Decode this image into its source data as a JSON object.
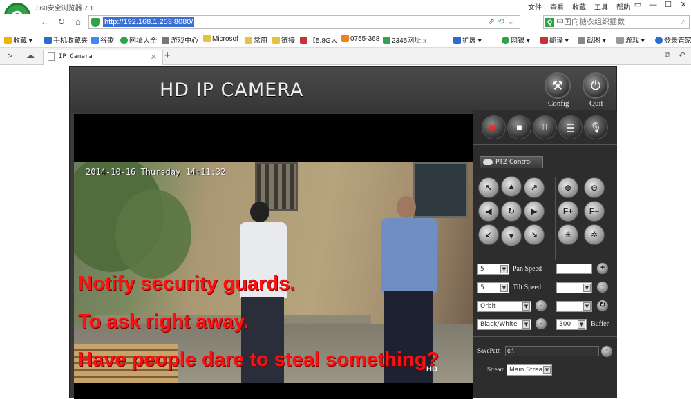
{
  "browser": {
    "app_title": "360安全浏览器 7.1",
    "menu": [
      "文件",
      "查看",
      "收藏",
      "工具",
      "帮助"
    ],
    "window_buttons": [
      "▭",
      "—",
      "☐",
      "✕"
    ],
    "logo_letter": "e",
    "url": "http://192.168.1.253:8080/",
    "search_placeholder": "中国向糖衣组织插数",
    "bookmarks": [
      "收藏",
      "手机收藏夹",
      "谷歌",
      "网址大全",
      "游戏中心",
      "Microsof",
      "常用",
      "链接",
      "【5.8G大",
      "0755-368",
      "2345网址",
      "扩展",
      "网银",
      "翻译",
      "截图",
      "游戏",
      "登录管家"
    ],
    "tab_title": "IP Camera",
    "colors": {
      "green": "#2fa24a",
      "url_highlight": "#3b6fd4"
    }
  },
  "camera": {
    "title": "HD IP CAMERA",
    "config_label": "Config",
    "quit_label": "Quit",
    "timestamp": "2014-10-16 Thursday 14:11:32",
    "overlay_lines": [
      "Notify security guards.",
      "To ask right away.",
      "Have people dare to steal something?"
    ],
    "watermark": "HD",
    "overlay_color": "#ff1010",
    "panel": {
      "ptz_label": "PTZ Control",
      "pan_speed_value": "5",
      "pan_speed_label": "Pan Speed",
      "tilt_speed_value": "5",
      "tilt_speed_label": "Tilt Speed",
      "orbit_value": "Orbit",
      "color_mode_value": "Black/White",
      "buffer_value": "300",
      "buffer_label": "Buffer",
      "savepath_label": "SavePath",
      "savepath_value": "c:\\",
      "stream_label": "Stream",
      "stream_value": "Main Strea"
    }
  }
}
